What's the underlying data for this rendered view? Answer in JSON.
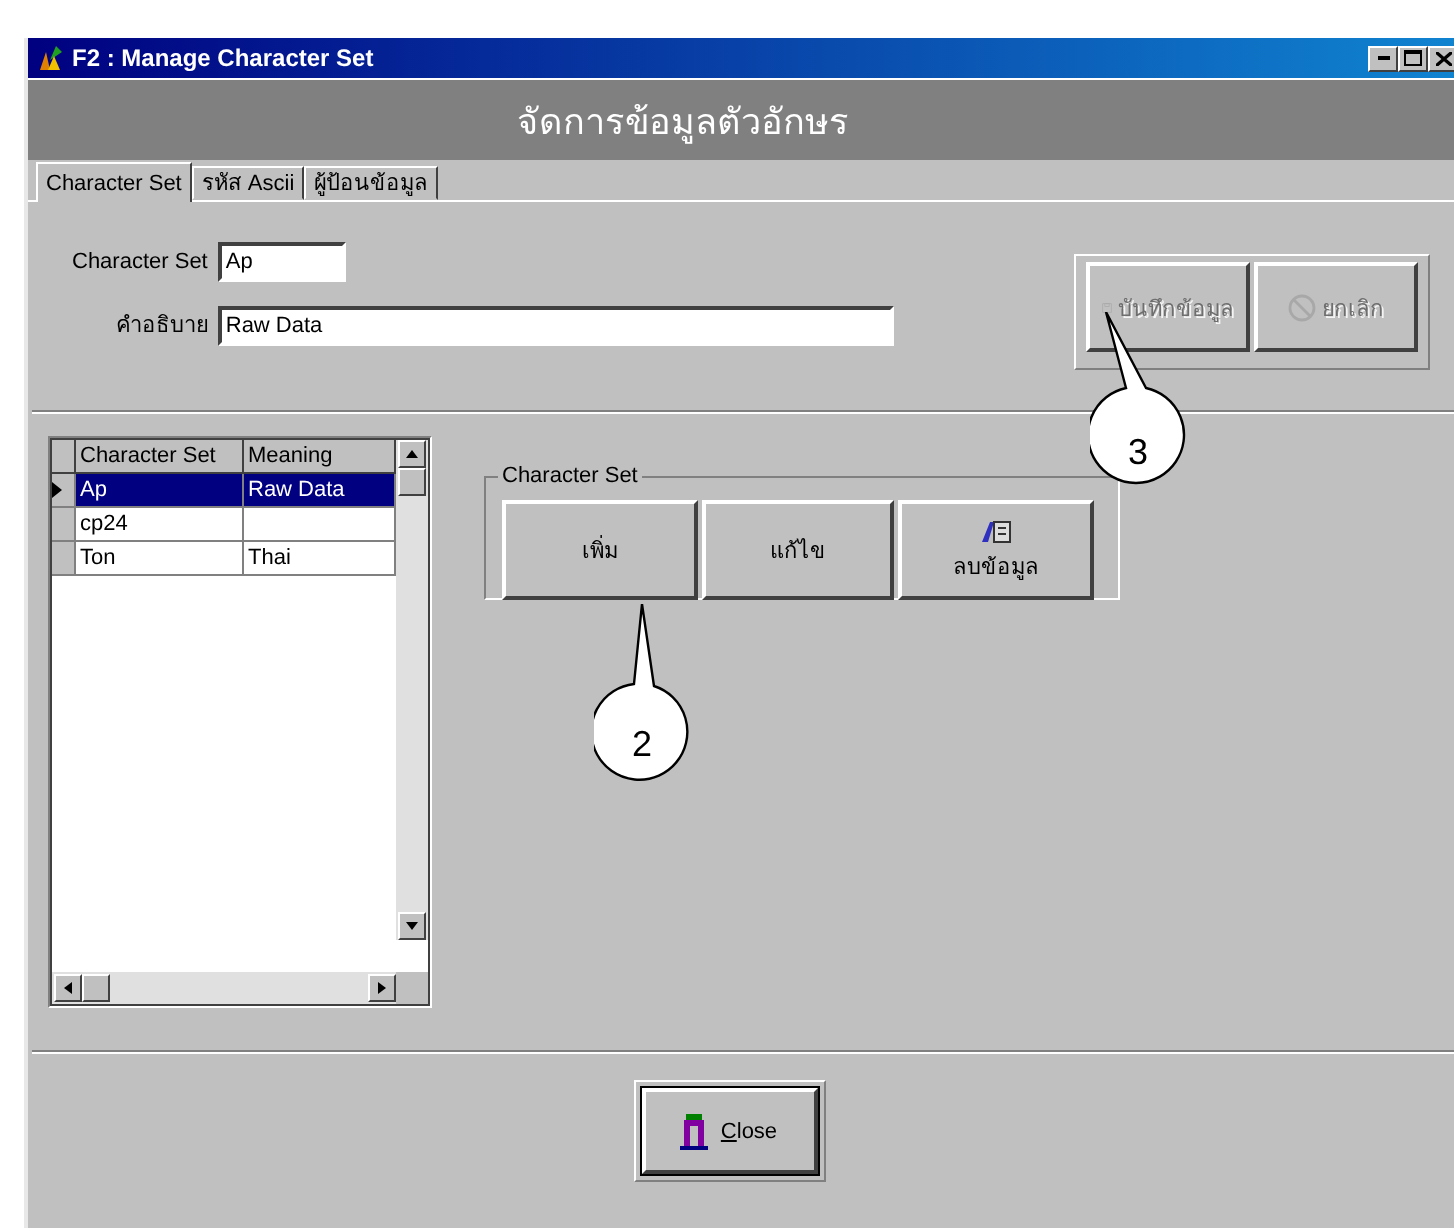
{
  "window": {
    "title": "F2 : Manage Character Set"
  },
  "header": "จัดการข้อมูลตัวอักษร",
  "tabs": [
    {
      "label": "Character Set",
      "selected": true
    },
    {
      "label": "รหัส Ascii",
      "selected": false
    },
    {
      "label": "ผู้ป้อนข้อมูล",
      "selected": false
    }
  ],
  "fields": [
    {
      "label": "Character Set",
      "value": "Ap"
    },
    {
      "label": "คำอธิบาย",
      "value": "Raw Data"
    }
  ],
  "actions": [
    {
      "label": "บันทึกข้อมูล",
      "disabled": true
    },
    {
      "label": "ยกเลิก",
      "disabled": true
    }
  ],
  "grid": {
    "columns": [
      "Character Set",
      "Meaning"
    ],
    "rows": [
      {
        "cells": [
          "Ap",
          "Raw Data"
        ],
        "selected": true
      },
      {
        "cells": [
          "cp24"
        ],
        "selected": false
      },
      {
        "cells": [
          "Ton",
          "Thai"
        ],
        "selected": false
      }
    ]
  },
  "group": {
    "title": "Character Set",
    "buttons": [
      {
        "label": "เพิ่ม"
      },
      {
        "label": "แก้ไข"
      },
      {
        "label": "ลบข้อมูล"
      }
    ]
  },
  "close_button": {
    "label": "Close"
  },
  "callouts": [
    {
      "label": "2"
    },
    {
      "label": "3"
    }
  ]
}
